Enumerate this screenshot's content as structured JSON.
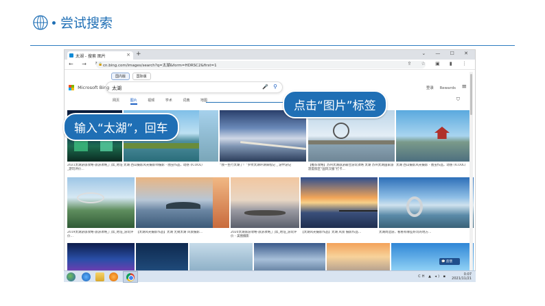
{
  "slide": {
    "title": "尝试搜索",
    "accent_color": "#1f6fb5"
  },
  "browser": {
    "tab_title": "太湖 - 搜索 图片",
    "tab_close": "×",
    "new_tab": "+",
    "window_controls": "⌄ — ☐ ✕",
    "nav_icons": "← → ↻",
    "url": "cn.bing.com/images/search?q=太湖&form=HDRSC2&first=1",
    "right_icons": "⇪ ☆ ▣ ▮ ⋮"
  },
  "bing": {
    "region_domestic": "国内版",
    "region_international": "国际版",
    "logo_text": "Microsoft Bing",
    "search_value": "太湖",
    "login_label": "登录",
    "rewards_label": "Rewards",
    "nav_tabs": [
      "网页",
      "图片",
      "视频",
      "学术",
      "词典",
      "地图"
    ],
    "active_tab": "图片"
  },
  "callouts": {
    "input": "输入“太湖”，回车",
    "click": "点击“图片”标签"
  },
  "captions": [
    "2021太湖游旅攻略-旅游攻略_门票_地址_游玩评价…",
    "太湖 西山摄影风光摄影师摄影 - 图虫作品，动感 (ICOOL)",
    "“我一生行太湖了！”罗纹太湖环湖骑程记 _ 游伴游记",
    "【推荐攻略】苏州太湖旅游最佳游玩攻略 太湖 苏州太湖国家旅游度假区“国风汉服”打卡…",
    "太湖 西山摄影风光摄影 - 图虫作品，动感 (ICOOL)",
    "2019太湖游旅攻略-旅游攻略_门票_地址_游玩评价…",
    "【太湖风光摄影作品】太湖 无锡太湖 风景摄影…",
    "2020太湖旅游攻略-旅游攻略_门票_地址_游玩评价 - 美图摄影",
    "【太湖风光摄影作品】太湖 风景 摄影作品…",
    "太湖周边游，看看有哪些好玩的地方…"
  ],
  "taskbar": {
    "time": "0:07",
    "date": "2021/11/21",
    "tray_icons": "CH ▲ ◂) ▪"
  },
  "chat_label": "💬 反馈"
}
